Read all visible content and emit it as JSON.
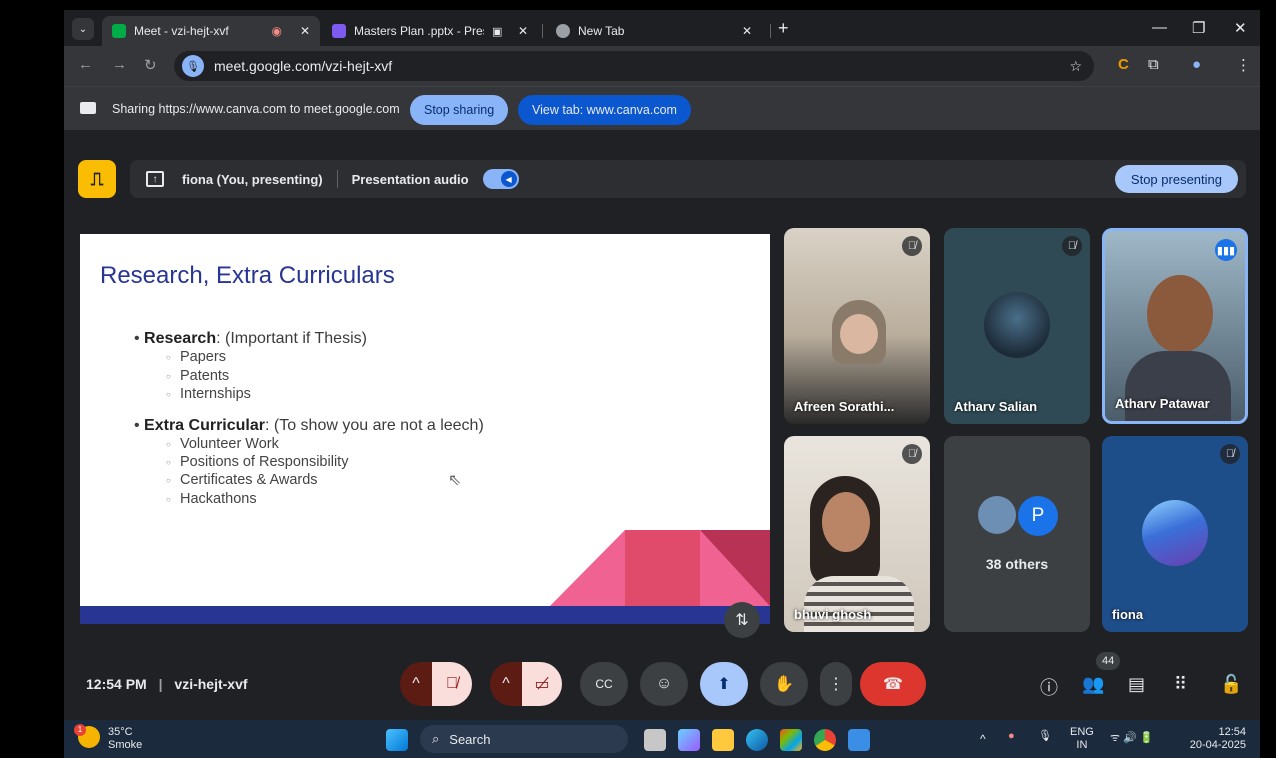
{
  "browser": {
    "tabs": [
      {
        "title": "Meet - vzi-hejt-xvf",
        "active": true
      },
      {
        "title": "Masters Plan .pptx - Presen",
        "active": false
      },
      {
        "title": "New Tab",
        "active": false
      }
    ],
    "url": "meet.google.com/vzi-hejt-xvf",
    "new_tab_label": "+"
  },
  "sharing_bar": {
    "text": "Sharing https://www.canva.com to meet.google.com",
    "stop_sharing": "Stop sharing",
    "view_tab": "View tab: www.canva.com"
  },
  "presenting_bar": {
    "presenter": "fiona (You, presenting)",
    "audio_label": "Presentation audio",
    "stop_presenting": "Stop presenting"
  },
  "slide": {
    "title": "Research, Extra Curriculars",
    "bullets": [
      {
        "bold": "Research",
        "rest": ": (Important if Thesis)",
        "subs": [
          "Papers",
          "Patents",
          "Internships"
        ]
      },
      {
        "bold": "Extra Curricular",
        "rest": ": (To show you are not a leech)",
        "subs": [
          "Volunteer Work",
          "Positions of Responsibility",
          "Certificates & Awards",
          "Hackathons"
        ]
      }
    ]
  },
  "participants": [
    {
      "name": "Afreen Sorathi...",
      "muted": true
    },
    {
      "name": "Atharv Salian",
      "muted": true
    },
    {
      "name": "Atharv Patawar",
      "speaking": true
    },
    {
      "name": "bhuvi ghosh",
      "muted": true
    },
    {
      "others_initial": "P",
      "others_label": "38 others"
    },
    {
      "name": "fiona",
      "muted": true
    }
  ],
  "controls": {
    "time": "12:54 PM",
    "meeting_code": "vzi-hejt-xvf",
    "participant_count": "44"
  },
  "taskbar": {
    "temperature": "35°C",
    "weather": "Smoke",
    "weather_badge": "1",
    "search": "Search",
    "lang": "ENG",
    "region": "IN",
    "clock_time": "12:54",
    "clock_date": "20-04-2025"
  }
}
